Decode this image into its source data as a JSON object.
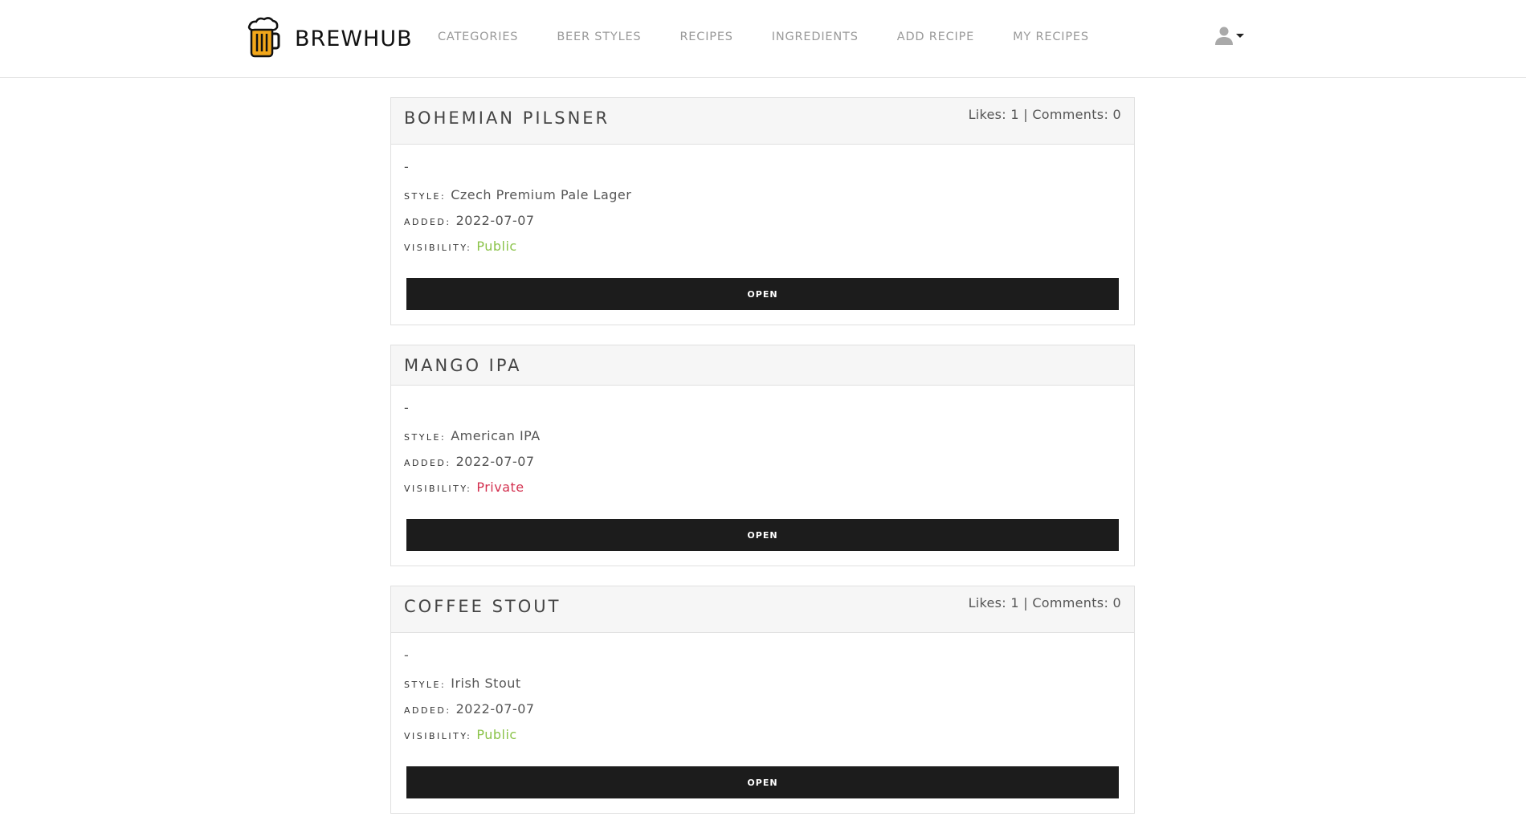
{
  "brand": {
    "name": "BREWHUB",
    "icon": "beer-mug-icon"
  },
  "nav": {
    "items": [
      {
        "label": "CATEGORIES"
      },
      {
        "label": "BEER STYLES"
      },
      {
        "label": "RECIPES"
      },
      {
        "label": "INGREDIENTS"
      },
      {
        "label": "ADD RECIPE"
      },
      {
        "label": "MY RECIPES"
      }
    ]
  },
  "user_menu": {
    "icon": "user-icon"
  },
  "colors": {
    "public": "#8bc34a",
    "private": "#d32f4e",
    "button": "#1c1c1c",
    "beer": "#f2a71b"
  },
  "labels": {
    "style": "STYLE:",
    "added": "ADDED:",
    "visibility": "VISIBILITY:",
    "open": "OPEN"
  },
  "recipes": [
    {
      "title": "BOHEMIAN PILSNER",
      "stats": "Likes: 1 | Comments: 0",
      "description": "-",
      "style": "Czech Premium Pale Lager",
      "added": "2022-07-07",
      "visibility": "Public"
    },
    {
      "title": "MANGO IPA",
      "stats": "",
      "description": "-",
      "style": "American IPA",
      "added": "2022-07-07",
      "visibility": "Private"
    },
    {
      "title": "COFFEE STOUT",
      "stats": "Likes: 1 | Comments: 0",
      "description": "-",
      "style": "Irish Stout",
      "added": "2022-07-07",
      "visibility": "Public"
    }
  ]
}
